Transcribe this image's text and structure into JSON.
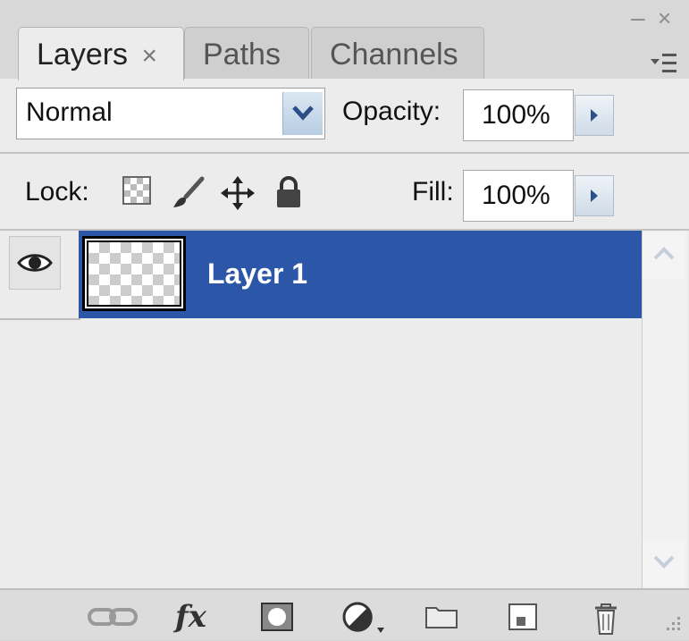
{
  "panel": {
    "tabs": [
      {
        "label": "Layers",
        "close": "×",
        "active": true
      },
      {
        "label": "Paths",
        "active": false
      },
      {
        "label": "Channels",
        "active": false
      }
    ],
    "window_controls": {
      "minimize": "–",
      "close": "×"
    }
  },
  "blend": {
    "mode": "Normal"
  },
  "opacity": {
    "label": "Opacity:",
    "value": "100%"
  },
  "lock": {
    "label": "Lock:"
  },
  "fill": {
    "label": "Fill:",
    "value": "100%"
  },
  "layers": [
    {
      "name": "Layer 1",
      "visible": true,
      "selected": true
    }
  ],
  "colors": {
    "selection": "#2c57a8",
    "panel_bg": "#ececec",
    "chrome": "#d8d8d8"
  },
  "bottom_toolbar": {
    "icons": [
      "link-layers-icon",
      "fx-icon",
      "add-mask-icon",
      "adjustment-layer-icon",
      "new-group-icon",
      "new-layer-icon",
      "trash-icon"
    ],
    "fx_label": "fx"
  }
}
